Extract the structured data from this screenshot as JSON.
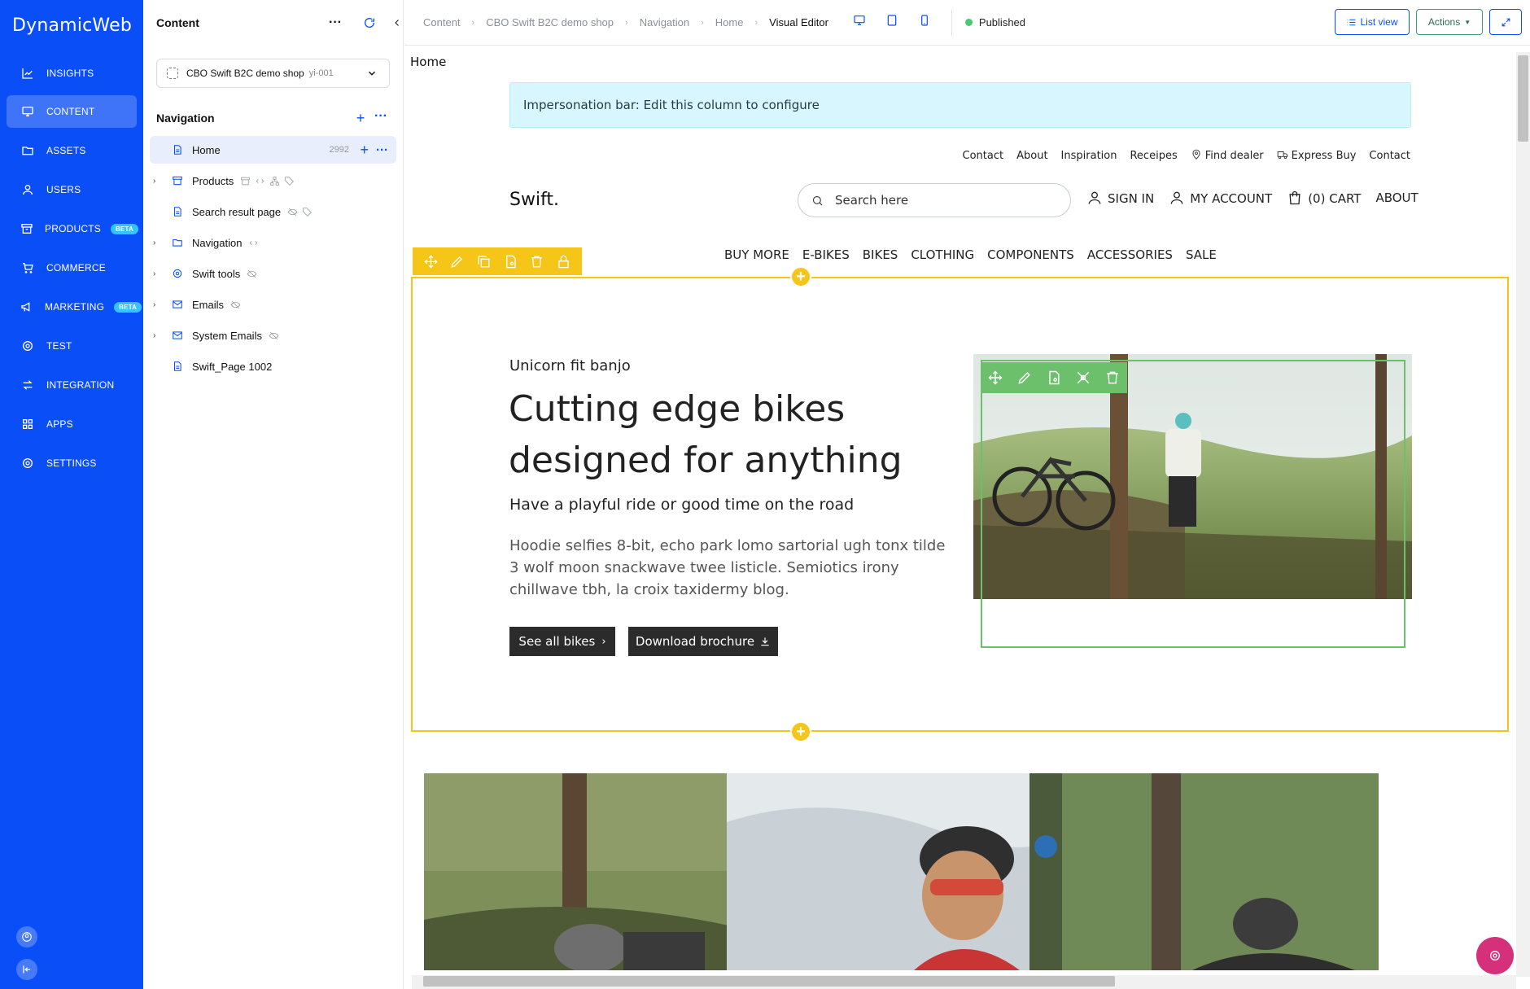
{
  "app": {
    "logo": "DynamicWeb",
    "nav": [
      {
        "label": "INSIGHTS",
        "icon": "chart-line-icon"
      },
      {
        "label": "CONTENT",
        "icon": "monitor-icon",
        "active": true
      },
      {
        "label": "ASSETS",
        "icon": "folder-icon"
      },
      {
        "label": "USERS",
        "icon": "user-icon"
      },
      {
        "label": "PRODUCTS",
        "icon": "archive-box-icon",
        "badge": "BETA"
      },
      {
        "label": "COMMERCE",
        "icon": "cart-icon"
      },
      {
        "label": "MARKETING",
        "icon": "megaphone-icon",
        "badge": "BETA"
      },
      {
        "label": "TEST",
        "icon": "gear-icon"
      },
      {
        "label": "INTEGRATION",
        "icon": "arrows-swap-icon"
      },
      {
        "label": "APPS",
        "icon": "grid-icon"
      },
      {
        "label": "SETTINGS",
        "icon": "gear-icon"
      }
    ]
  },
  "tree": {
    "title": "Content",
    "shop": {
      "name": "CBO Swift B2C demo shop",
      "code": "yi-001"
    },
    "nav_heading": "Navigation",
    "items": [
      {
        "label": "Home",
        "count": "2992",
        "active": true,
        "icon": "page-icon",
        "caret": false
      },
      {
        "label": "Products",
        "icon": "archive-box-icon",
        "caret": true
      },
      {
        "label": "Search result page",
        "icon": "page-icon",
        "caret": false
      },
      {
        "label": "Navigation",
        "icon": "folder-icon",
        "caret": true
      },
      {
        "label": "Swift tools",
        "icon": "gear-icon",
        "caret": true
      },
      {
        "label": "Emails",
        "icon": "mail-icon",
        "caret": true
      },
      {
        "label": "System Emails",
        "icon": "mail-icon",
        "caret": true
      },
      {
        "label": "Swift_Page 1002",
        "icon": "page-icon",
        "caret": false
      }
    ]
  },
  "topbar": {
    "breadcrumbs": [
      "Content",
      "CBO Swift B2C demo shop",
      "Navigation",
      "Home",
      "Visual Editor"
    ],
    "status": "Published",
    "list_view": "List view",
    "actions": "Actions",
    "status_color": "#48c774"
  },
  "preview": {
    "page_label": "Home",
    "impersonation": "Impersonation bar: Edit this column to configure",
    "util_nav": [
      "Contact",
      "About",
      "Inspiration",
      "Receipes",
      "Find dealer",
      "Express Buy",
      "Contact"
    ],
    "brand": "Swift.",
    "search_placeholder": "Search here",
    "account": [
      "SIGN IN",
      "MY ACCOUNT",
      "(0) CART",
      "ABOUT"
    ],
    "menu": [
      "BUY MORE",
      "E-BIKES",
      "BIKES",
      "CLOTHING",
      "COMPONENTS",
      "ACCESSORIES",
      "SALE"
    ],
    "hero": {
      "kicker": "Unicorn fit banjo",
      "title": "Cutting edge bikes designed for anything",
      "subtitle": "Have a playful ride or good time on the road",
      "body": "Hoodie selfies 8-bit, echo park lomo sartorial ugh tonx tilde 3 wolf moon snackwave twee listicle. Semiotics irony chillwave tbh, la croix taxidermy blog.",
      "btn_primary": "See all bikes",
      "btn_secondary": "Download brochure"
    }
  },
  "colors": {
    "brand_blue": "#0a4ef7",
    "row_highlight": "#f5c518",
    "column_highlight": "#6cc06c",
    "fab": "#d6307b"
  }
}
